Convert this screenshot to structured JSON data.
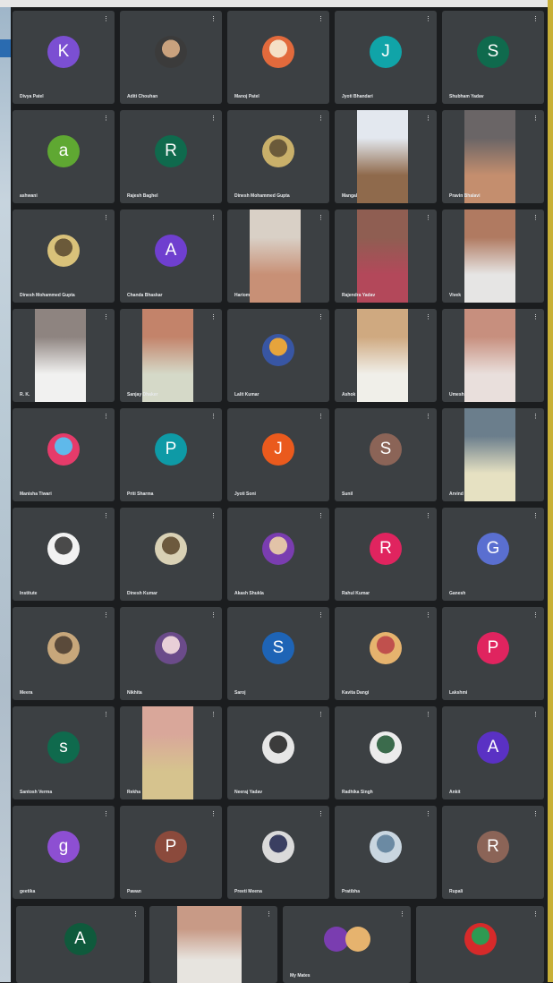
{
  "meeting": {
    "rows": [
      [
        {
          "type": "initial",
          "letter": "K",
          "color": "#7b4fd2"
        },
        {
          "type": "photo",
          "colors": [
            "#3b3b3b",
            "#c9a27e"
          ]
        },
        {
          "type": "photo",
          "colors": [
            "#e26a3c",
            "#f5e0c6"
          ]
        },
        {
          "type": "initial",
          "letter": "J",
          "color": "#10a4a8"
        },
        {
          "type": "initial",
          "letter": "S",
          "color": "#0f6a4d"
        }
      ],
      [
        {
          "type": "initial",
          "letter": "a",
          "color": "#5fa832"
        },
        {
          "type": "initial",
          "letter": "R",
          "color": "#0f6a4d"
        },
        {
          "type": "photo",
          "colors": [
            "#c9b06a",
            "#6b5a3a"
          ]
        },
        {
          "type": "video",
          "colors": [
            "#8f6a4c",
            "#e3e8ef"
          ]
        },
        {
          "type": "video",
          "colors": [
            "#c48e6e",
            "#6a6566"
          ]
        }
      ],
      [
        {
          "type": "photo",
          "colors": [
            "#d9c27a",
            "#6b5a3a"
          ]
        },
        {
          "type": "initial",
          "letter": "A",
          "color": "#6f3fcf"
        },
        {
          "type": "video",
          "colors": [
            "#c89076",
            "#d9d0c6"
          ]
        },
        {
          "type": "video",
          "colors": [
            "#b3485a",
            "#8f5e52"
          ]
        },
        {
          "type": "video",
          "colors": [
            "#e6e5e4",
            "#b07a61"
          ]
        }
      ],
      [
        {
          "type": "video",
          "colors": [
            "#f1f1f0",
            "#8e8480"
          ]
        },
        {
          "type": "video",
          "colors": [
            "#d5d9c8",
            "#c3836a"
          ]
        },
        {
          "type": "photo",
          "colors": [
            "#3856a4",
            "#e6a43c"
          ]
        },
        {
          "type": "video",
          "colors": [
            "#f0efe9",
            "#cfa980"
          ]
        },
        {
          "type": "video",
          "colors": [
            "#e9dfdc",
            "#c78f7e"
          ]
        }
      ],
      [
        {
          "type": "photo",
          "colors": [
            "#e53b6a",
            "#5fb9ea"
          ]
        },
        {
          "type": "initial",
          "letter": "P",
          "color": "#0e9aa6"
        },
        {
          "type": "initial",
          "letter": "J",
          "color": "#ea5a1d"
        },
        {
          "type": "initial",
          "letter": "S",
          "color": "#8b6457"
        },
        {
          "type": "video",
          "colors": [
            "#e6e1c2",
            "#6b7e8c"
          ]
        }
      ],
      [
        {
          "type": "photo",
          "colors": [
            "#f2f2f2",
            "#4a4a4a"
          ]
        },
        {
          "type": "photo",
          "colors": [
            "#d9d1b5",
            "#6d5a3e"
          ]
        },
        {
          "type": "photo",
          "colors": [
            "#7a3db0",
            "#e2c3a8"
          ]
        },
        {
          "type": "initial",
          "letter": "R",
          "color": "#e0245f"
        },
        {
          "type": "initial",
          "letter": "G",
          "color": "#5a6fd0"
        }
      ],
      [
        {
          "type": "photo",
          "colors": [
            "#c7a77b",
            "#5a4a3a"
          ]
        },
        {
          "type": "photo",
          "colors": [
            "#6b4b8a",
            "#e8cfd7"
          ]
        },
        {
          "type": "initial",
          "letter": "S",
          "color": "#1e64b6"
        },
        {
          "type": "photo",
          "colors": [
            "#e6b36e",
            "#c0504d"
          ]
        },
        {
          "type": "initial",
          "letter": "P",
          "color": "#e0245f"
        }
      ],
      [
        {
          "type": "initial",
          "letter": "s",
          "color": "#0f6a4d"
        },
        {
          "type": "video",
          "colors": [
            "#d6c38e",
            "#d9a79a"
          ]
        },
        {
          "type": "photo",
          "colors": [
            "#e6e6e6",
            "#3c3c3c"
          ]
        },
        {
          "type": "photo",
          "colors": [
            "#ececec",
            "#3b6b4c"
          ]
        },
        {
          "type": "initial",
          "letter": "A",
          "color": "#5a31c4"
        }
      ],
      [
        {
          "type": "initial",
          "letter": "g",
          "color": "#8d4fd2"
        },
        {
          "type": "initial",
          "letter": "P",
          "color": "#8b4a3c"
        },
        {
          "type": "photo",
          "colors": [
            "#dadada",
            "#3a3f61"
          ]
        },
        {
          "type": "photo",
          "colors": [
            "#c9d6e0",
            "#6b8aa3"
          ]
        },
        {
          "type": "initial",
          "letter": "R",
          "color": "#8b6457"
        }
      ]
    ],
    "bottom_row": [
      {
        "type": "initial",
        "letter": "A",
        "color": "#0f5a3c"
      },
      {
        "type": "video",
        "colors": [
          "#e7e4df",
          "#c89a86"
        ]
      },
      {
        "type": "group",
        "colors": [
          "#7a3db0",
          "#e6b36e"
        ]
      },
      {
        "type": "photo",
        "colors": [
          "#d62a2a",
          "#2e9a52"
        ]
      }
    ],
    "names": [
      [
        "Divya Patel",
        "Aditi Chouhan",
        "Manoj Patel",
        "Jyoti Bhandari",
        "Shubham Yadav"
      ],
      [
        "ashwani",
        "Rajesh Baghel",
        "Dinesh Mohammed Gupta",
        "Mangal",
        "Pravin Bhalavi"
      ],
      [
        "Dinesh Mohammed Gupta",
        "Chanda Bhaskar",
        "Hariom",
        "Rajendra Yadav",
        "Vivek"
      ],
      [
        "R. K.",
        "Sanjay Dhaker",
        "Lalit Kumar",
        "Ashok",
        "Umesh"
      ],
      [
        "Manisha Tiwari",
        "Priti Sharma",
        "Jyoti Soni",
        "Sunil",
        "Arvind"
      ],
      [
        "Institute",
        "Dinesh Kumar",
        "Akash Shukla",
        "Rahul Kumar",
        "Ganesh"
      ],
      [
        "Meera",
        "Nikhita",
        "Saroj",
        "Kavita Dangi",
        "Lakshmi"
      ],
      [
        "Santosh Verma",
        "Rekha",
        "Neeraj Yadav",
        "Radhika Singh",
        "Ankit"
      ],
      [
        "geetika",
        "Pawan",
        "Preeti Meena",
        "Pratibha",
        "Rupali"
      ]
    ],
    "bottom_names": [
      "",
      "",
      "My Mates",
      ""
    ],
    "accent": "#c8b037",
    "tile_bg": "#3c4043"
  }
}
